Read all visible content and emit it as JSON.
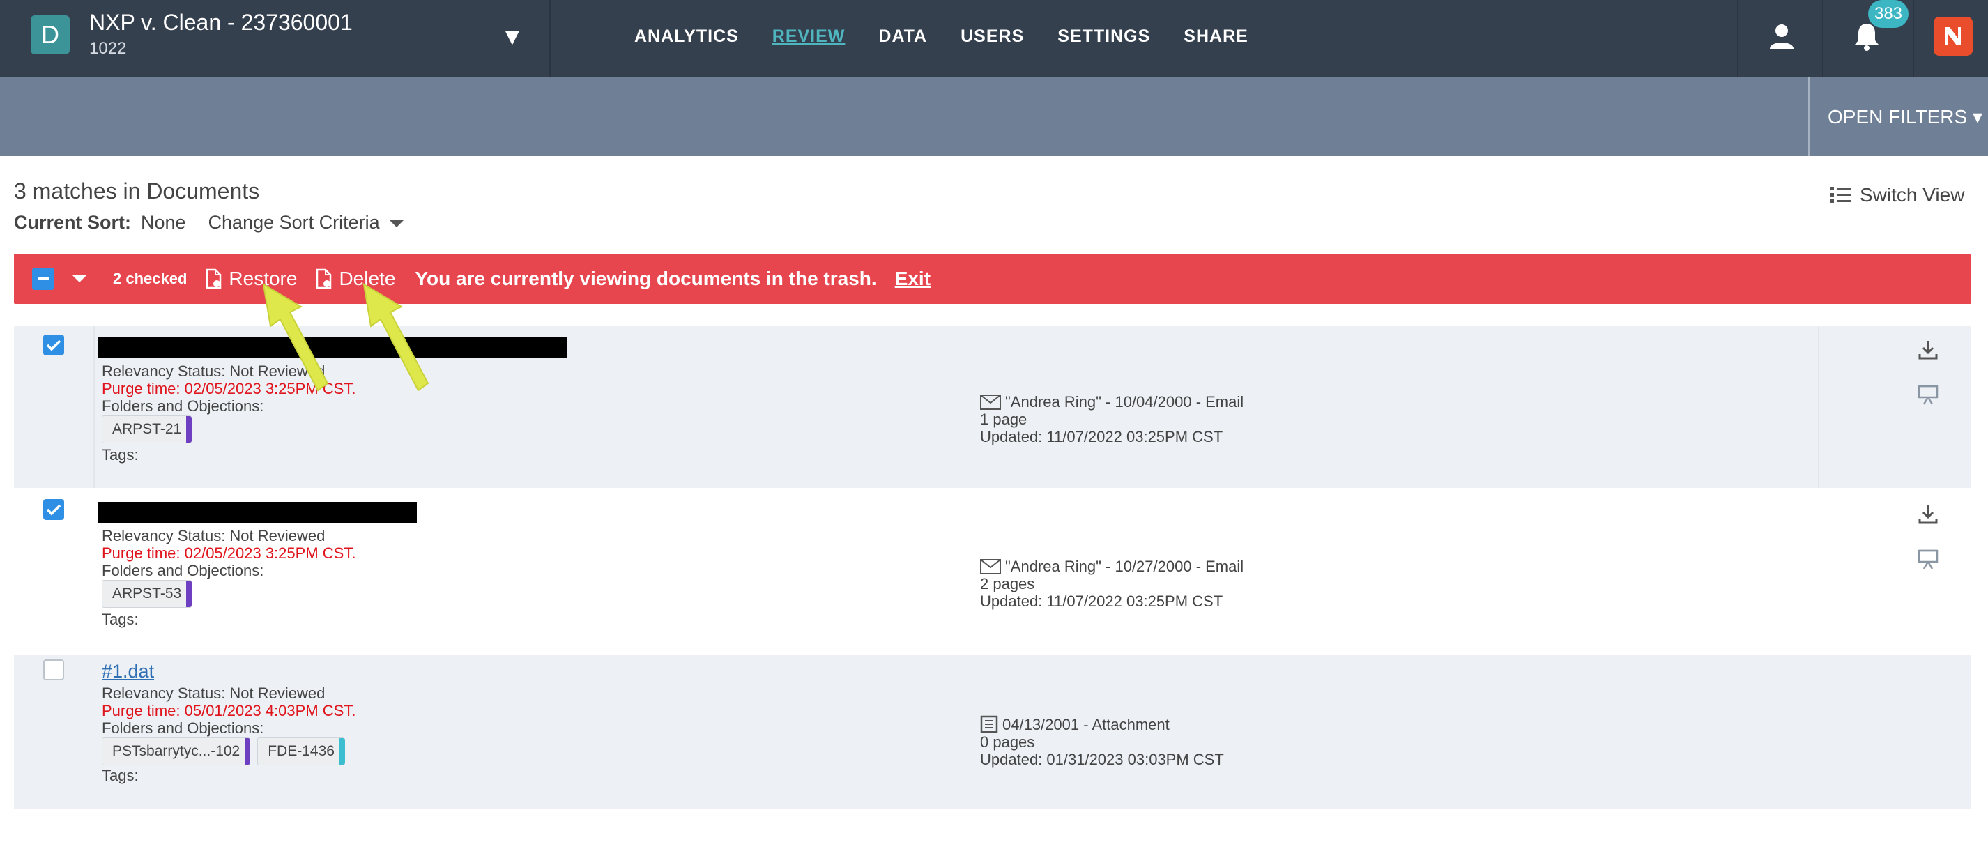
{
  "header": {
    "avatar_letter": "D",
    "project_title": "NXP v. Clean - 237360001",
    "project_sub": "1022",
    "nav": [
      "ANALYTICS",
      "REVIEW",
      "DATA",
      "USERS",
      "SETTINGS",
      "SHARE"
    ],
    "active_nav": "REVIEW",
    "notification_count": "383",
    "colors": {
      "topbar": "#35404f",
      "accent": "#4fb6c0",
      "brand": "#ea4d2b"
    }
  },
  "filters": {
    "open_label": "OPEN FILTERS ▾"
  },
  "results": {
    "matches": "3 matches in Documents",
    "sort_label": "Current Sort:",
    "sort_value": "None",
    "change_sort": "Change Sort Criteria",
    "switch_view": "Switch View"
  },
  "actionbar": {
    "checked": "2 checked",
    "restore": "Restore",
    "delete": "Delete",
    "message": "You are currently viewing documents in the trash.",
    "exit": "Exit",
    "color": "#e8464f"
  },
  "rows": [
    {
      "checked": true,
      "title": "",
      "relevancy": "Relevancy Status: Not Reviewed",
      "purge": "Purge time: 02/05/2023 3:25PM CST.",
      "folders": "Folders and Objections:",
      "chips": [
        "ARPST-21"
      ],
      "tags": "Tags:",
      "info_line": "\"Andrea Ring\" - 10/04/2000 - Email",
      "pages": "1 page",
      "updated": "Updated: 11/07/2022 03:25PM CST",
      "info_icon": "email-icon"
    },
    {
      "checked": true,
      "title": "",
      "relevancy": "Relevancy Status: Not Reviewed",
      "purge": "Purge time: 02/05/2023 3:25PM CST.",
      "folders": "Folders and Objections:",
      "chips": [
        "ARPST-53"
      ],
      "tags": "Tags:",
      "info_line": "\"Andrea Ring\" - 10/27/2000 - Email",
      "pages": "2 pages",
      "updated": "Updated: 11/07/2022 03:25PM CST",
      "info_icon": "email-icon"
    },
    {
      "checked": false,
      "title": "#1.dat",
      "relevancy": "Relevancy Status: Not Reviewed",
      "purge": "Purge time: 05/01/2023 4:03PM CST.",
      "folders": "Folders and Objections:",
      "chips": [
        "PSTsbarrytyc...-102",
        "FDE-1436"
      ],
      "tags": "Tags:",
      "info_line": "04/13/2001 - Attachment",
      "pages": "0 pages",
      "updated": "Updated: 01/31/2023 03:03PM CST",
      "info_icon": "attachment-doc-icon"
    }
  ]
}
